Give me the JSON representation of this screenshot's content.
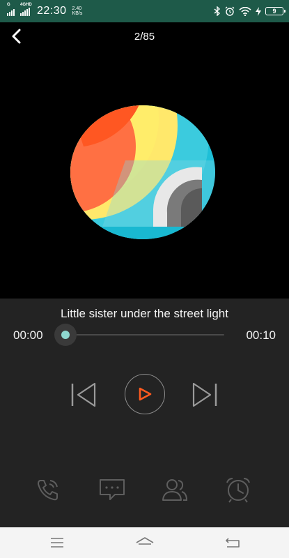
{
  "status_bar": {
    "sim1_tag": "G",
    "sim2_tag": "4GHD",
    "time": "22:30",
    "net_speed_value": "2.40",
    "net_speed_unit": "KB/s",
    "battery_level": "9",
    "icons": [
      "bluetooth-icon",
      "alarm-icon",
      "wifi-icon",
      "charging-icon",
      "battery-icon"
    ]
  },
  "header": {
    "back_icon": "chevron-left-icon",
    "track_counter": "2/85"
  },
  "player": {
    "song_title": "Little sister under the street light",
    "current_time": "00:00",
    "duration": "00:10",
    "progress": 0.0,
    "controls": [
      "previous-icon",
      "play-icon",
      "next-icon"
    ]
  },
  "actions": [
    "phone-call-icon",
    "message-icon",
    "contacts-icon",
    "alarm-clock-icon"
  ],
  "system_nav": [
    "menu-icon",
    "home-icon",
    "back-icon"
  ],
  "colors": {
    "status_bar_bg": "#1e5a49",
    "player_bg": "#232323",
    "accent_knob": "#8fd8cf",
    "play_icon": "#ff5a1f"
  }
}
